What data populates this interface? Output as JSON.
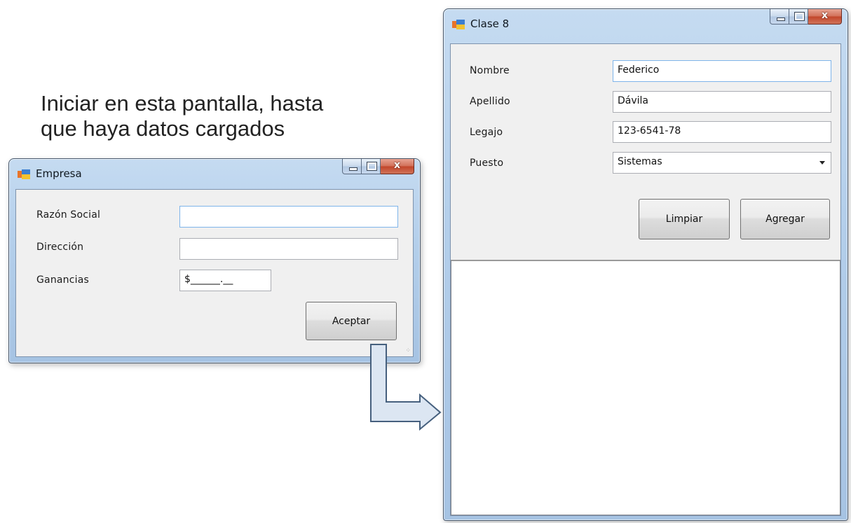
{
  "caption": "Iniciar en esta pantalla, hasta\nque haya datos cargados",
  "empresa_window": {
    "title": "Empresa",
    "fields": [
      {
        "label": "Razón Social",
        "value": ""
      },
      {
        "label": "Dirección",
        "value": ""
      },
      {
        "label": "Ganancias",
        "value": "$______.__"
      }
    ],
    "accept_label": "Aceptar"
  },
  "clase_window": {
    "title": "Clase 8",
    "fields": [
      {
        "label": "Nombre",
        "value": "Federico"
      },
      {
        "label": "Apellido",
        "value": "Dávila"
      },
      {
        "label": "Legajo",
        "value": "123-6541-78"
      },
      {
        "label": "Puesto",
        "value": "Sistemas"
      }
    ],
    "clear_label": "Limpiar",
    "add_label": "Agregar"
  },
  "caption_buttons": {
    "close_glyph": "x"
  },
  "icons": {
    "window_icon": "app-window-icon",
    "arrow": "flow-arrow-icon"
  },
  "colors": {
    "arrow_fill": "#dce6f2",
    "arrow_stroke": "#46607e",
    "window_frame": "#b4cfeb"
  }
}
